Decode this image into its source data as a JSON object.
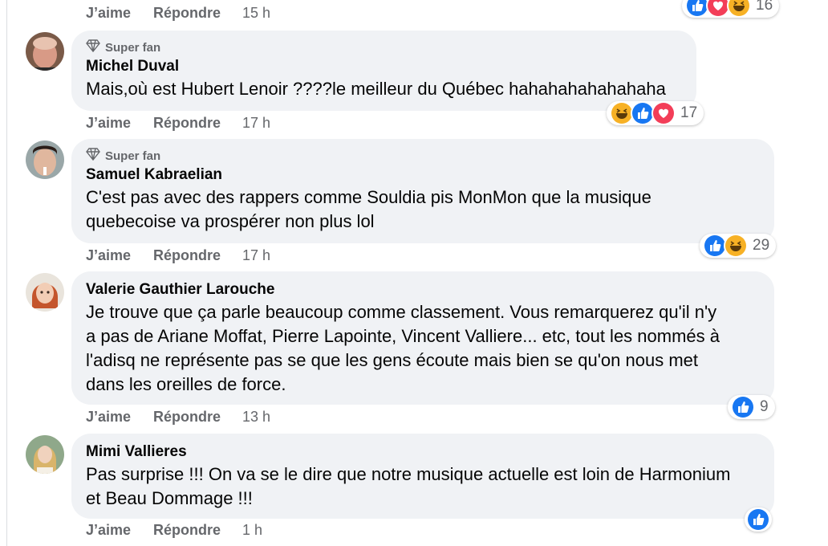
{
  "actions": {
    "like": "J’aime",
    "reply": "Répondre"
  },
  "badge": {
    "superfan_label": "Super fan"
  },
  "colors": {
    "like_blue": "#1877f2",
    "love_red": "#f33e58",
    "haha_yellow": "#f7b125",
    "bubble": "#f0f2f5",
    "muted": "#65676b"
  },
  "comments": [
    {
      "time": "15 h",
      "reaction_count": "16",
      "reactions": [
        "like-icon",
        "love-icon",
        "haha-icon"
      ]
    },
    {
      "author": "Michel Duval",
      "superfan": true,
      "text": "Mais,où est Hubert Lenoir ????le meilleur du Québec hahahahahahahaha",
      "time": "17 h",
      "reaction_count": "17",
      "reactions": [
        "haha-icon",
        "like-icon",
        "love-icon"
      ]
    },
    {
      "author": "Samuel Kabraelian",
      "superfan": true,
      "text_lines": [
        "C'est pas avec des rappers comme Souldia pis MonMon que la musique",
        "quebecoise va prospérer non plus lol"
      ],
      "time": "17 h",
      "reaction_count": "29",
      "reactions": [
        "like-icon",
        "haha-icon"
      ]
    },
    {
      "author": "Valerie Gauthier Larouche",
      "superfan": false,
      "text_lines": [
        "Je trouve que ça parle beaucoup comme classement. Vous remarquerez qu'il n'y",
        "a pas de Ariane Moffat, Pierre Lapointe, Vincent Valliere... etc, tout les nommés à",
        "l'adisq ne représente pas se que les gens écoute mais bien se qu'on nous met",
        "dans les oreilles de force."
      ],
      "time": "13 h",
      "reaction_count": "9",
      "reactions": [
        "like-icon"
      ]
    },
    {
      "author": "Mimi Vallieres",
      "superfan": false,
      "text_lines": [
        "Pas surprise !!! On va se le dire que notre musique actuelle est loin de Harmonium",
        "et Beau Dommage !!!"
      ],
      "time": "1 h",
      "reactions": [
        "like-icon"
      ]
    }
  ]
}
